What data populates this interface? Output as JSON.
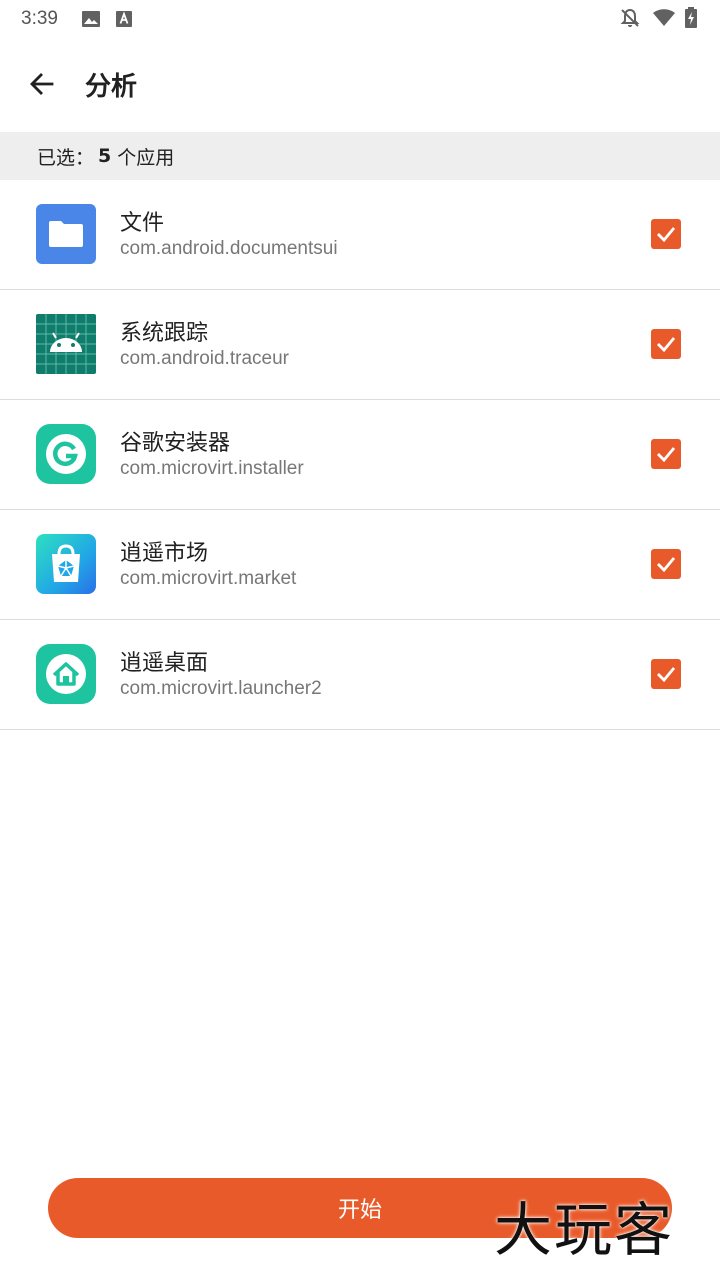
{
  "status_bar": {
    "time": "3:39",
    "left_icons": [
      "image-icon",
      "text-a-icon"
    ],
    "right_icons": [
      "notifications-off-icon",
      "wifi-icon",
      "battery-charging-icon"
    ]
  },
  "app_bar": {
    "title": "分析",
    "back_icon": "arrow-back-icon"
  },
  "selection": {
    "prefix": "已选：",
    "count": "5",
    "suffix": "个应用"
  },
  "apps": [
    {
      "name": "文件",
      "package": "com.android.documentsui",
      "checked": true,
      "icon": "files-folder-icon"
    },
    {
      "name": "系统跟踪",
      "package": "com.android.traceur",
      "checked": true,
      "icon": "android-trace-icon"
    },
    {
      "name": "谷歌安装器",
      "package": "com.microvirt.installer",
      "checked": true,
      "icon": "google-installer-icon"
    },
    {
      "name": "逍遥市场",
      "package": "com.microvirt.market",
      "checked": true,
      "icon": "market-bag-icon"
    },
    {
      "name": "逍遥桌面",
      "package": "com.microvirt.launcher2",
      "checked": true,
      "icon": "launcher-home-icon"
    }
  ],
  "start_button": {
    "label": "开始"
  },
  "watermark": {
    "text": "大玩客"
  },
  "colors": {
    "accent": "#e95a2a",
    "header_bg": "#eeeeee",
    "divider": "#dddddd"
  }
}
